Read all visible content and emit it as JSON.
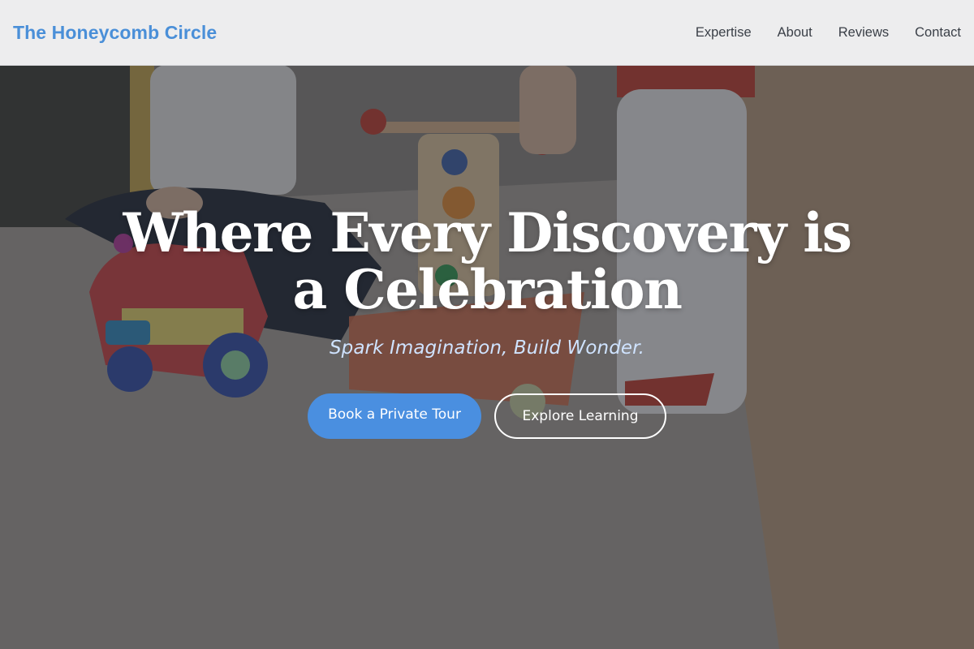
{
  "header": {
    "brand": "The Honeycomb Circle",
    "nav": [
      {
        "label": "Expertise"
      },
      {
        "label": "About"
      },
      {
        "label": "Reviews"
      },
      {
        "label": "Contact"
      }
    ]
  },
  "hero": {
    "headline_line1": "Where Every Discovery is",
    "headline_line2": "a Celebration",
    "tagline": "Spark Imagination, Build Wonder.",
    "primary_cta": "Book a Private Tour",
    "secondary_cta": "Explore Learning",
    "background_image": "children-playing-with-toys-photo"
  },
  "colors": {
    "brand": "#4a8fd8",
    "primary_button": "#4a8fe0",
    "tagline": "#cfe3ff",
    "headline": "#ffffff"
  }
}
